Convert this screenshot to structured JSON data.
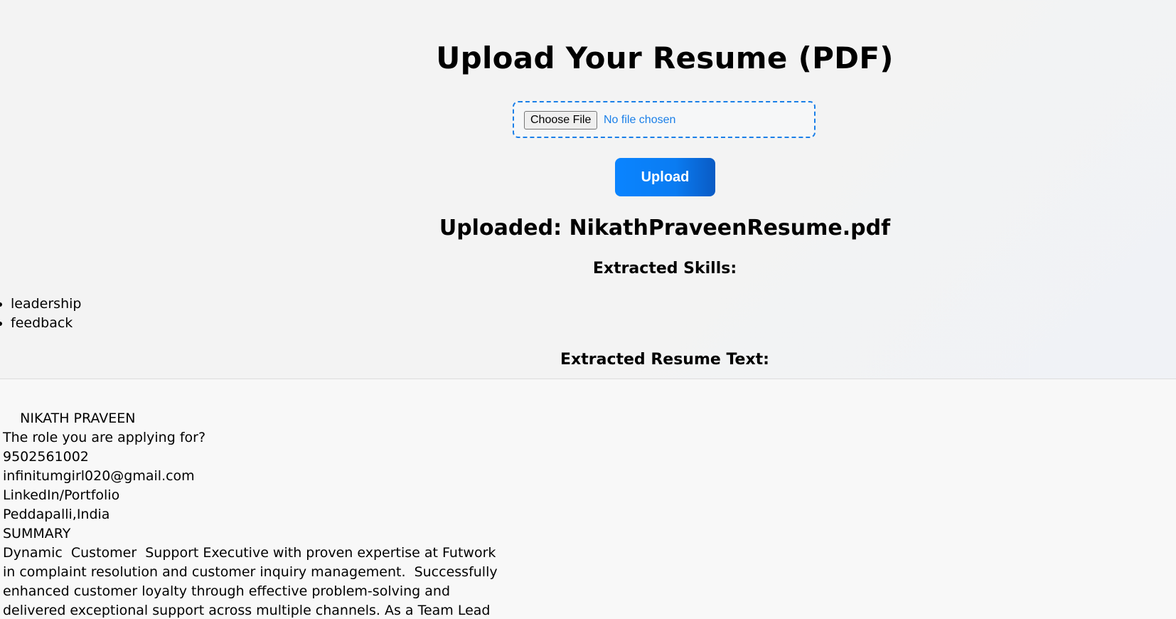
{
  "page_title": "Upload Your Resume (PDF)",
  "file_input": {
    "button_label": "Choose File",
    "status_text": "No file chosen"
  },
  "upload_button_label": "Upload",
  "uploaded_heading": "Uploaded: NikathPraveenResume.pdf",
  "skills": {
    "heading": "Extracted Skills:",
    "items": [
      "leadership",
      "feedback"
    ]
  },
  "resume_text": {
    "heading": "Extracted Resume Text:",
    "lines": [
      "    NIKATH PRAVEEN",
      "The role you are applying for?",
      "9502561002",
      "infinitumgirl020@gmail.com",
      "LinkedIn/Portfolio",
      "Peddapalli,India",
      "SUMMARY",
      "Dynamic  Customer  Support Executive with proven expertise at Futwork",
      "in complaint resolution and customer inquiry management.  Successfully",
      "enhanced customer loyalty through effective problem-solving and",
      "delivered exceptional support across multiple channels. As a Team Lead"
    ]
  },
  "colors": {
    "accent": "#1a7fe8",
    "upload_button": "#0a84ff",
    "background": "#f3f3f3"
  }
}
